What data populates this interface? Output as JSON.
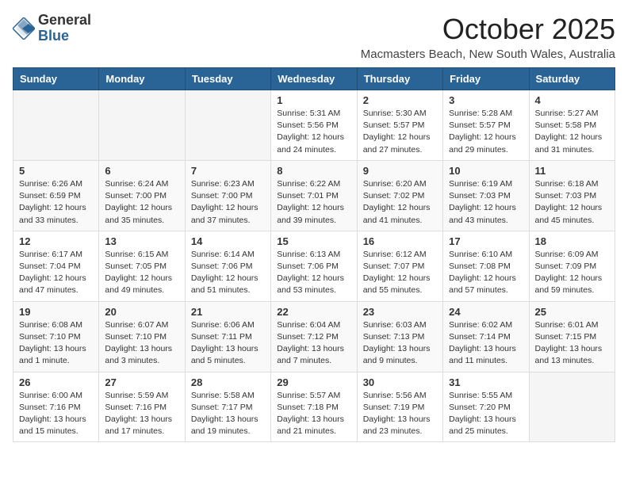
{
  "header": {
    "logo_general": "General",
    "logo_blue": "Blue",
    "month": "October 2025",
    "location": "Macmasters Beach, New South Wales, Australia"
  },
  "days_of_week": [
    "Sunday",
    "Monday",
    "Tuesday",
    "Wednesday",
    "Thursday",
    "Friday",
    "Saturday"
  ],
  "weeks": [
    [
      {
        "day": "",
        "info": ""
      },
      {
        "day": "",
        "info": ""
      },
      {
        "day": "",
        "info": ""
      },
      {
        "day": "1",
        "info": "Sunrise: 5:31 AM\nSunset: 5:56 PM\nDaylight: 12 hours\nand 24 minutes."
      },
      {
        "day": "2",
        "info": "Sunrise: 5:30 AM\nSunset: 5:57 PM\nDaylight: 12 hours\nand 27 minutes."
      },
      {
        "day": "3",
        "info": "Sunrise: 5:28 AM\nSunset: 5:57 PM\nDaylight: 12 hours\nand 29 minutes."
      },
      {
        "day": "4",
        "info": "Sunrise: 5:27 AM\nSunset: 5:58 PM\nDaylight: 12 hours\nand 31 minutes."
      }
    ],
    [
      {
        "day": "5",
        "info": "Sunrise: 6:26 AM\nSunset: 6:59 PM\nDaylight: 12 hours\nand 33 minutes."
      },
      {
        "day": "6",
        "info": "Sunrise: 6:24 AM\nSunset: 7:00 PM\nDaylight: 12 hours\nand 35 minutes."
      },
      {
        "day": "7",
        "info": "Sunrise: 6:23 AM\nSunset: 7:00 PM\nDaylight: 12 hours\nand 37 minutes."
      },
      {
        "day": "8",
        "info": "Sunrise: 6:22 AM\nSunset: 7:01 PM\nDaylight: 12 hours\nand 39 minutes."
      },
      {
        "day": "9",
        "info": "Sunrise: 6:20 AM\nSunset: 7:02 PM\nDaylight: 12 hours\nand 41 minutes."
      },
      {
        "day": "10",
        "info": "Sunrise: 6:19 AM\nSunset: 7:03 PM\nDaylight: 12 hours\nand 43 minutes."
      },
      {
        "day": "11",
        "info": "Sunrise: 6:18 AM\nSunset: 7:03 PM\nDaylight: 12 hours\nand 45 minutes."
      }
    ],
    [
      {
        "day": "12",
        "info": "Sunrise: 6:17 AM\nSunset: 7:04 PM\nDaylight: 12 hours\nand 47 minutes."
      },
      {
        "day": "13",
        "info": "Sunrise: 6:15 AM\nSunset: 7:05 PM\nDaylight: 12 hours\nand 49 minutes."
      },
      {
        "day": "14",
        "info": "Sunrise: 6:14 AM\nSunset: 7:06 PM\nDaylight: 12 hours\nand 51 minutes."
      },
      {
        "day": "15",
        "info": "Sunrise: 6:13 AM\nSunset: 7:06 PM\nDaylight: 12 hours\nand 53 minutes."
      },
      {
        "day": "16",
        "info": "Sunrise: 6:12 AM\nSunset: 7:07 PM\nDaylight: 12 hours\nand 55 minutes."
      },
      {
        "day": "17",
        "info": "Sunrise: 6:10 AM\nSunset: 7:08 PM\nDaylight: 12 hours\nand 57 minutes."
      },
      {
        "day": "18",
        "info": "Sunrise: 6:09 AM\nSunset: 7:09 PM\nDaylight: 12 hours\nand 59 minutes."
      }
    ],
    [
      {
        "day": "19",
        "info": "Sunrise: 6:08 AM\nSunset: 7:10 PM\nDaylight: 13 hours\nand 1 minute."
      },
      {
        "day": "20",
        "info": "Sunrise: 6:07 AM\nSunset: 7:10 PM\nDaylight: 13 hours\nand 3 minutes."
      },
      {
        "day": "21",
        "info": "Sunrise: 6:06 AM\nSunset: 7:11 PM\nDaylight: 13 hours\nand 5 minutes."
      },
      {
        "day": "22",
        "info": "Sunrise: 6:04 AM\nSunset: 7:12 PM\nDaylight: 13 hours\nand 7 minutes."
      },
      {
        "day": "23",
        "info": "Sunrise: 6:03 AM\nSunset: 7:13 PM\nDaylight: 13 hours\nand 9 minutes."
      },
      {
        "day": "24",
        "info": "Sunrise: 6:02 AM\nSunset: 7:14 PM\nDaylight: 13 hours\nand 11 minutes."
      },
      {
        "day": "25",
        "info": "Sunrise: 6:01 AM\nSunset: 7:15 PM\nDaylight: 13 hours\nand 13 minutes."
      }
    ],
    [
      {
        "day": "26",
        "info": "Sunrise: 6:00 AM\nSunset: 7:16 PM\nDaylight: 13 hours\nand 15 minutes."
      },
      {
        "day": "27",
        "info": "Sunrise: 5:59 AM\nSunset: 7:16 PM\nDaylight: 13 hours\nand 17 minutes."
      },
      {
        "day": "28",
        "info": "Sunrise: 5:58 AM\nSunset: 7:17 PM\nDaylight: 13 hours\nand 19 minutes."
      },
      {
        "day": "29",
        "info": "Sunrise: 5:57 AM\nSunset: 7:18 PM\nDaylight: 13 hours\nand 21 minutes."
      },
      {
        "day": "30",
        "info": "Sunrise: 5:56 AM\nSunset: 7:19 PM\nDaylight: 13 hours\nand 23 minutes."
      },
      {
        "day": "31",
        "info": "Sunrise: 5:55 AM\nSunset: 7:20 PM\nDaylight: 13 hours\nand 25 minutes."
      },
      {
        "day": "",
        "info": ""
      }
    ]
  ]
}
